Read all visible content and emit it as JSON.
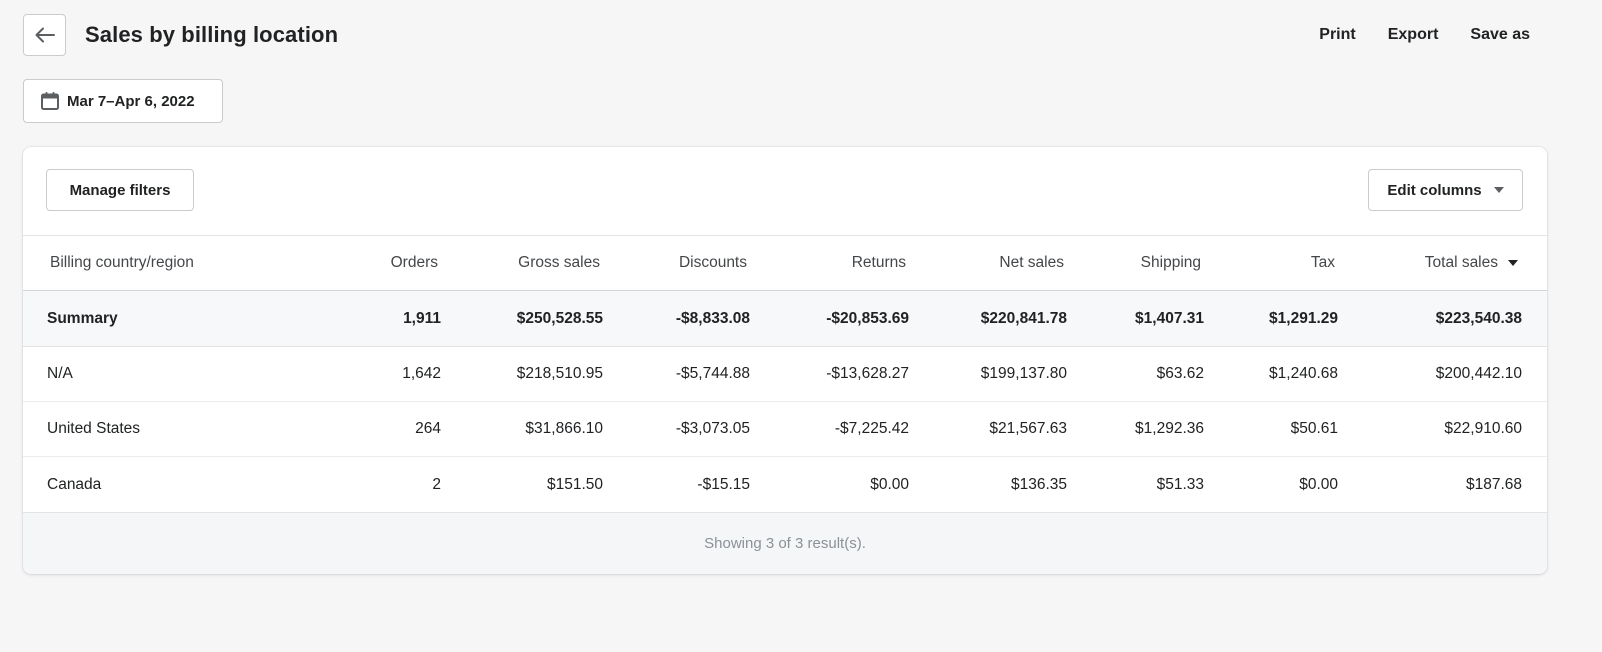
{
  "page": {
    "title": "Sales by billing location",
    "back_icon": "arrow-left-icon"
  },
  "header_actions": {
    "print": "Print",
    "export": "Export",
    "save_as": "Save as"
  },
  "date_range": {
    "icon": "calendar-icon",
    "label": "Mar 7–Apr 6, 2022"
  },
  "toolbar": {
    "manage_filters": "Manage filters",
    "edit_columns": "Edit columns",
    "edit_columns_icon": "caret-down-icon"
  },
  "table": {
    "columns": {
      "country": "Billing country/region",
      "orders": "Orders",
      "gross": "Gross sales",
      "discounts": "Discounts",
      "returns": "Returns",
      "net": "Net sales",
      "shipping": "Shipping",
      "tax": "Tax",
      "total": "Total sales"
    },
    "sort_icon": "sort-desc-icon",
    "summary": {
      "country": "Summary",
      "orders": "1,911",
      "gross": "$250,528.55",
      "discounts": "-$8,833.08",
      "returns": "-$20,853.69",
      "net": "$220,841.78",
      "shipping": "$1,407.31",
      "tax": "$1,291.29",
      "total": "$223,540.38"
    },
    "rows": [
      {
        "country": "N/A",
        "orders": "1,642",
        "gross": "$218,510.95",
        "discounts": "-$5,744.88",
        "returns": "-$13,628.27",
        "net": "$199,137.80",
        "shipping": "$63.62",
        "tax": "$1,240.68",
        "total": "$200,442.10"
      },
      {
        "country": "United States",
        "orders": "264",
        "gross": "$31,866.10",
        "discounts": "-$3,073.05",
        "returns": "-$7,225.42",
        "net": "$21,567.63",
        "shipping": "$1,292.36",
        "tax": "$50.61",
        "total": "$22,910.60"
      },
      {
        "country": "Canada",
        "orders": "2",
        "gross": "$151.50",
        "discounts": "-$15.15",
        "returns": "$0.00",
        "net": "$136.35",
        "shipping": "$51.33",
        "tax": "$0.00",
        "total": "$187.68"
      }
    ],
    "footer": "Showing 3 of 3 result(s)."
  }
}
